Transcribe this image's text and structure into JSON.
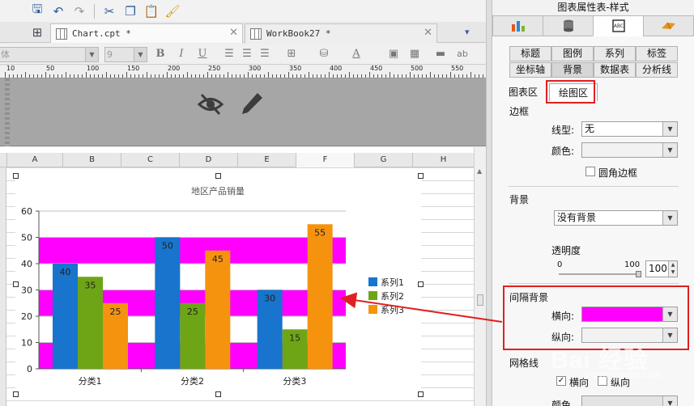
{
  "editor": {
    "tabs": [
      {
        "label": "Chart.cpt *"
      },
      {
        "label": "WorkBook27 *"
      }
    ],
    "format": {
      "font_name": "体",
      "font_size": "9",
      "bold": "B",
      "italic": "I",
      "underline": "U",
      "font_color_label": "A",
      "extra_label": "ab"
    },
    "ruler_numbers": [
      "10",
      "50",
      "100",
      "150",
      "200",
      "250",
      "300",
      "350",
      "400",
      "450",
      "500",
      "550"
    ]
  },
  "sheet": {
    "columns": [
      "A",
      "B",
      "C",
      "D",
      "E",
      "F",
      "G",
      "H"
    ]
  },
  "chart_data": {
    "type": "bar",
    "title": "地区产品销量",
    "categories": [
      "分类1",
      "分类2",
      "分类3"
    ],
    "series": [
      {
        "name": "系列1",
        "values": [
          40,
          50,
          30
        ],
        "color": "#1874cd"
      },
      {
        "name": "系列2",
        "values": [
          35,
          25,
          15
        ],
        "color": "#6ea517"
      },
      {
        "name": "系列3",
        "values": [
          25,
          45,
          55
        ],
        "color": "#f5930f"
      }
    ],
    "ylim": [
      0,
      60
    ],
    "yticks": [
      0,
      10,
      20,
      30,
      40,
      50,
      60
    ],
    "legend": "right",
    "interval_band_color": "#ff00ff"
  },
  "panel": {
    "title": "图表属性表-样式",
    "top_tabs": [
      {
        "icon": "chart-type-icon",
        "color": "#d28a1e"
      },
      {
        "icon": "data-icon",
        "color": "#555555"
      },
      {
        "icon": "style-icon",
        "color": "#333333"
      },
      {
        "icon": "effects-icon",
        "color": "#d28a1e"
      }
    ],
    "subtabs_row1": [
      "标题",
      "图例",
      "系列",
      "标签"
    ],
    "subtabs_row2": [
      "坐标轴",
      "背景",
      "数据表",
      "分析线"
    ],
    "area_tabs": [
      "图表区",
      "绘图区"
    ],
    "border": {
      "section": "边框",
      "line_type_label": "线型:",
      "line_type_value": "无",
      "color_label": "颜色:",
      "rounded_label": "圆角边框"
    },
    "background": {
      "section": "背景",
      "value": "没有背景",
      "transparency_label": "透明度",
      "slider_min": "0",
      "slider_max": "100",
      "transparency_value": "100"
    },
    "interval": {
      "section": "间隔背景",
      "horizontal_label": "横向:",
      "vertical_label": "纵向:"
    },
    "gridlines": {
      "section": "网格线",
      "horizontal_label": "横向",
      "vertical_label": "纵向",
      "color_label": "颜色"
    }
  },
  "watermark": {
    "text": "Bai 经验",
    "sub": "jingyan.baidu.com"
  }
}
